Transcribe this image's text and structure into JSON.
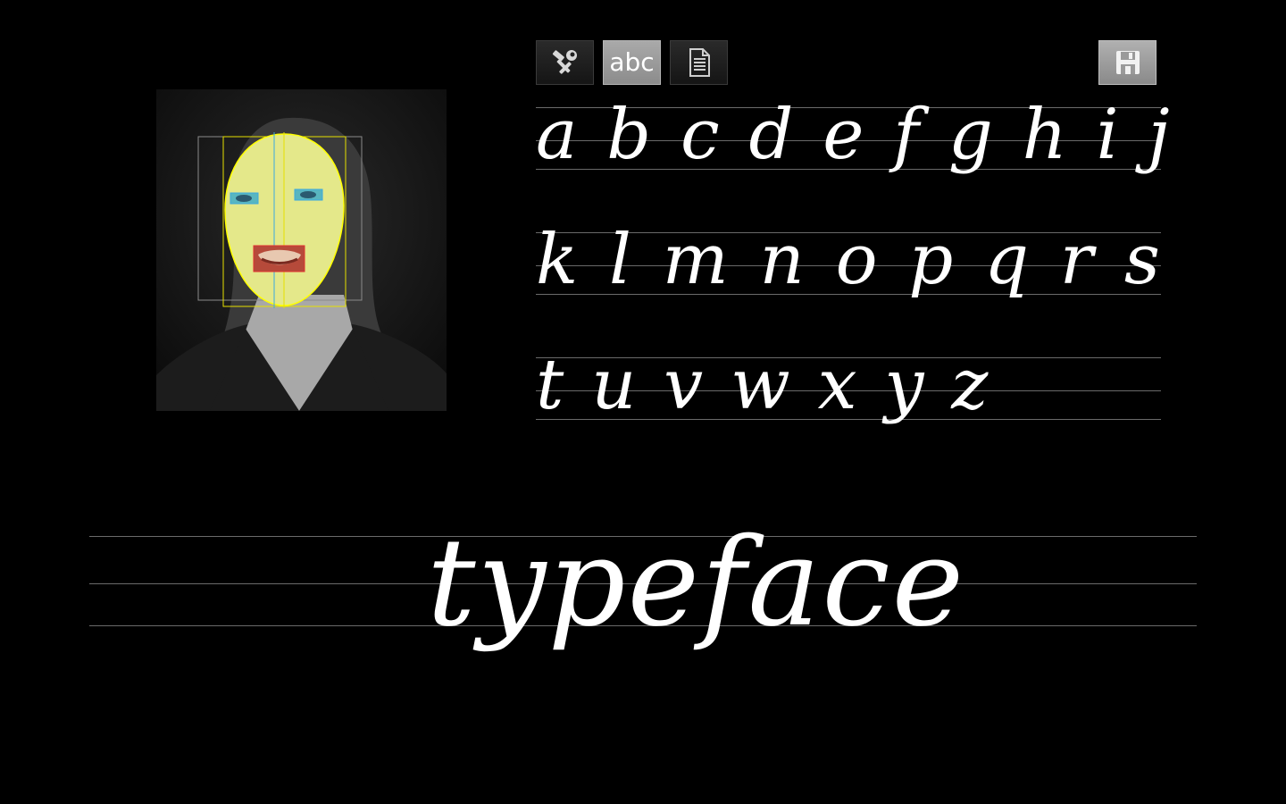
{
  "toolbar": {
    "tools_icon": "tools-icon",
    "abc_label": "abc",
    "document_icon": "document-icon",
    "save_icon": "save-icon",
    "active_tab": "abc",
    "active_color": "#9a9a9a"
  },
  "face_panel": {
    "overlay_face_color": "#e8ec8a",
    "overlay_eye_color": "#3aa8e0",
    "overlay_mouth_color": "#e03030",
    "overlay_outline_color": "#ffff00"
  },
  "alphabet": {
    "row1": "a b c d e f g h i j",
    "row2": "k l m n o p q r s",
    "row3": "t u v w x y z"
  },
  "sample": {
    "word": "typeface"
  }
}
